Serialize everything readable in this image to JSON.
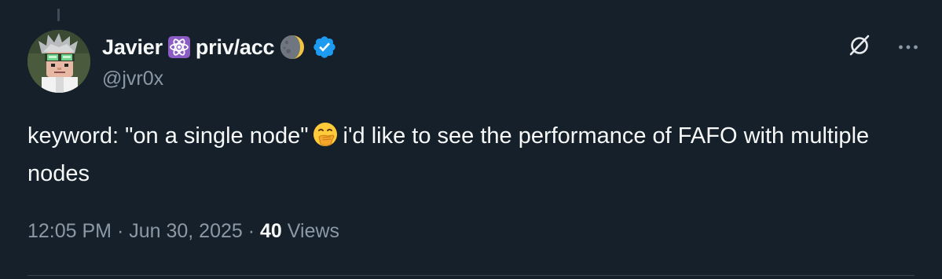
{
  "tweet": {
    "author": {
      "display_name": "Javier",
      "name_suffix": "priv/acc",
      "handle": "@jvr0x",
      "avatar_icon": "pixel-avatar-icon",
      "badges": [
        "atom-emoji-icon",
        "moon-emoji-icon",
        "verified-badge-icon"
      ]
    },
    "text": {
      "part1": "keyword: \"on a single node\"",
      "part2": "i'd like to see the performance of FAFO with multiple nodes"
    },
    "meta": {
      "time": "12:05 PM",
      "separator": " · ",
      "date": "Jun 30, 2025",
      "views_count": "40",
      "views_label": "Views"
    }
  },
  "colors": {
    "background": "#15202b",
    "text": "#f7f9f9",
    "muted": "#8b98a5",
    "verified": "#1d9bf0",
    "atom_badge": "#8b5cc4"
  }
}
